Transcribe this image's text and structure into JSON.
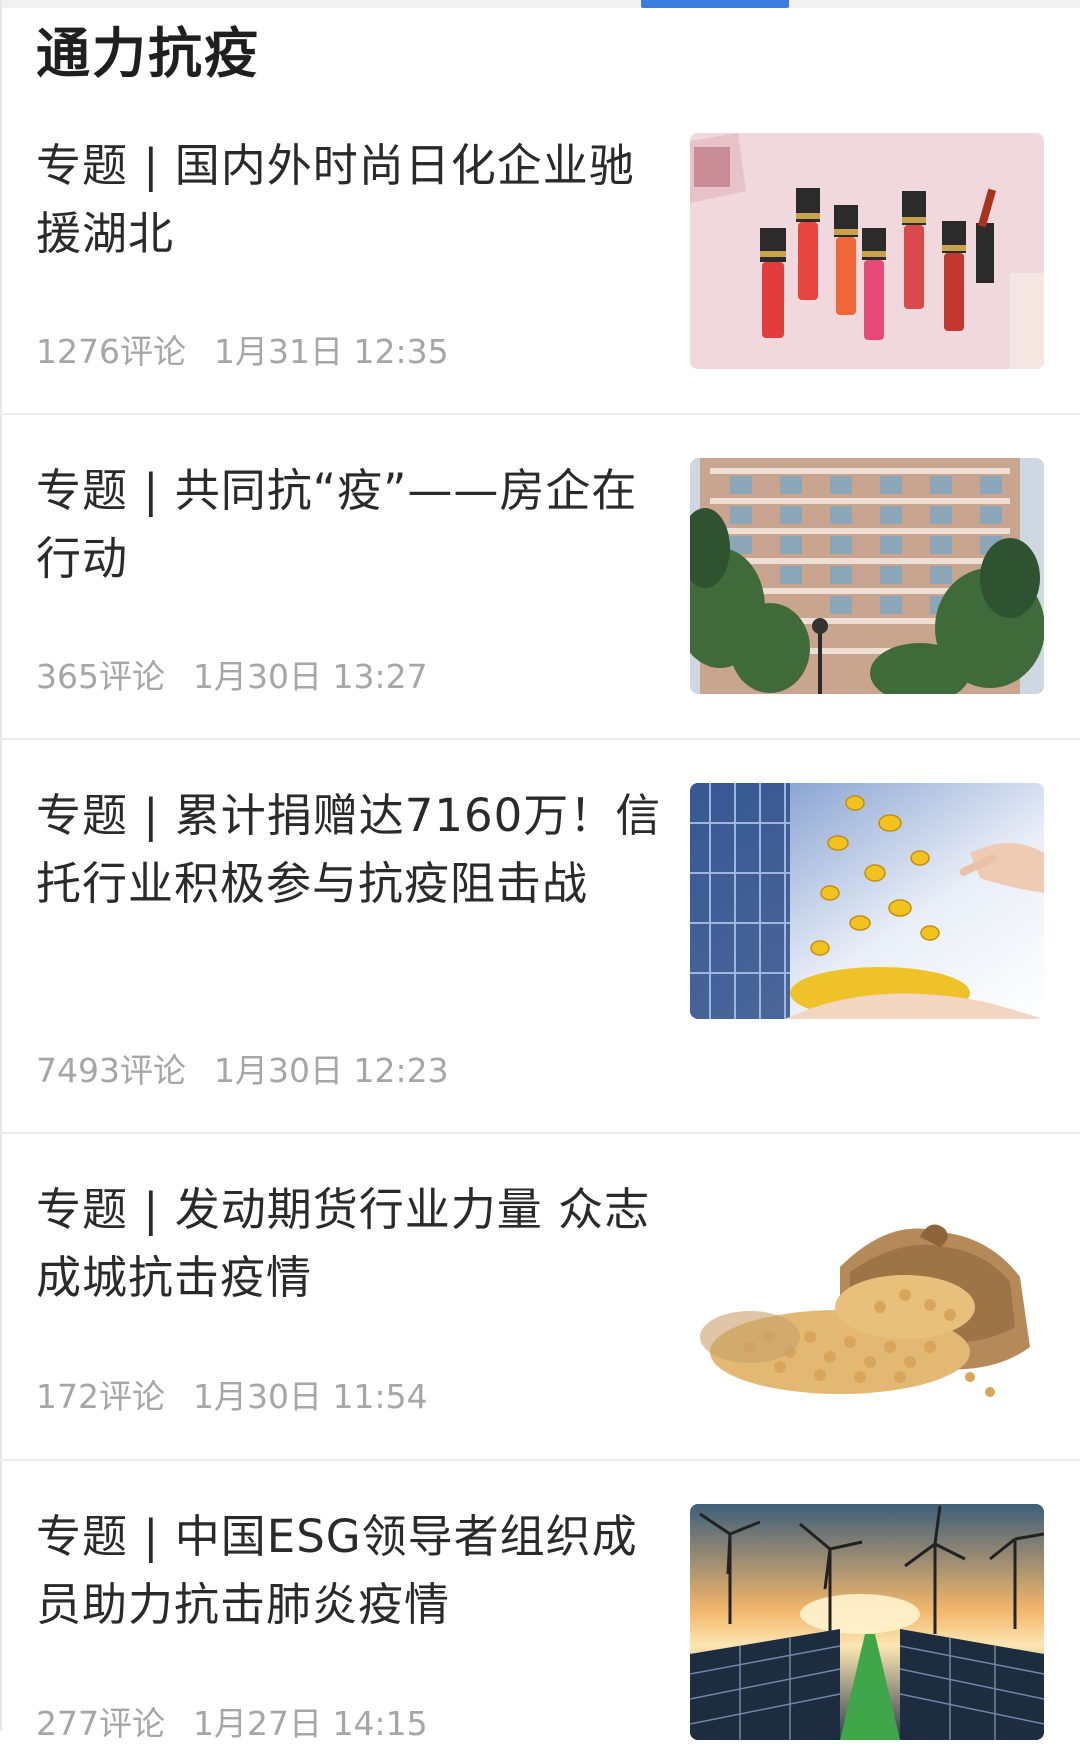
{
  "section": {
    "title": "通力抗疫"
  },
  "articles": [
    {
      "title": "专题 | 国内外时尚日化企业驰援湖北",
      "comments": "1276评论",
      "date": "1月31日 12:35",
      "thumbnail_icon": "lipstick-image"
    },
    {
      "title": "专题 | 共同抗“疫”——房企在行动",
      "comments": "365评论",
      "date": "1月30日 13:27",
      "thumbnail_icon": "apartment-building-image"
    },
    {
      "title": "专题 | 累计捐赠达7160万！信托行业积极参与抗疫阻击战",
      "comments": "7493评论",
      "date": "1月30日 12:23",
      "thumbnail_icon": "gold-coins-image"
    },
    {
      "title": "专题 | 发动期货行业力量 众志成城抗击疫情",
      "comments": "172评论",
      "date": "1月30日 11:54",
      "thumbnail_icon": "soybeans-image"
    },
    {
      "title": "专题 | 中国ESG领导者组织成员助力抗击肺炎疫情",
      "comments": "277评论",
      "date": "1月27日 14:15",
      "thumbnail_icon": "wind-solar-image"
    }
  ],
  "colors": {
    "accent": "#3b7ddd",
    "meta_text": "#a6a6a6",
    "divider": "#ececec"
  }
}
